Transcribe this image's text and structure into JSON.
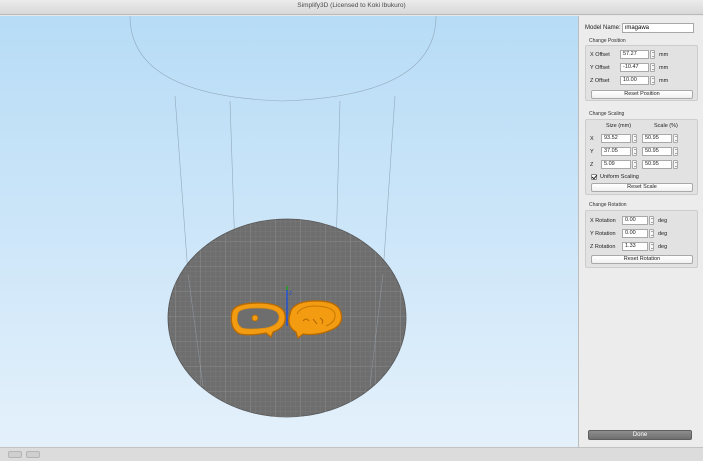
{
  "window": {
    "title": "Simplify3D (Licensed to Koki Ibukuro)"
  },
  "panel": {
    "model_name_label": "Model Name:",
    "model_name_value": "imagawa",
    "position": {
      "title": "Change Position",
      "x_label": "X Offset",
      "x_value": "57.27",
      "y_label": "Y Offset",
      "y_value": "-10.47",
      "z_label": "Z Offset",
      "z_value": "10.00",
      "unit": "mm",
      "reset_label": "Reset Position"
    },
    "scaling": {
      "title": "Change Scaling",
      "size_header": "Size (mm)",
      "scale_header": "Scale (%)",
      "x_label": "X",
      "x_size": "93.52",
      "x_scale": "50.95",
      "y_label": "Y",
      "y_size": "37.05",
      "y_scale": "50.95",
      "z_label": "Z",
      "z_size": "5.09",
      "z_scale": "50.95",
      "uniform_label": "Uniform Scaling",
      "uniform_checked": true,
      "reset_label": "Reset Scale"
    },
    "rotation": {
      "title": "Change Rotation",
      "x_label": "X Rotation",
      "x_value": "0.00",
      "y_label": "Y Rotation",
      "y_value": "0.00",
      "z_label": "Z Rotation",
      "z_value": "1.33",
      "unit": "deg",
      "reset_label": "Reset Rotation"
    },
    "done_label": "Done"
  },
  "colors": {
    "sky_top": "#b7dcf6",
    "bed": "#6e6e6e",
    "model": "#f39c12",
    "model_stroke": "#b86a00",
    "axis_z": "#1e4fd6",
    "axis_y": "#19a31c"
  }
}
